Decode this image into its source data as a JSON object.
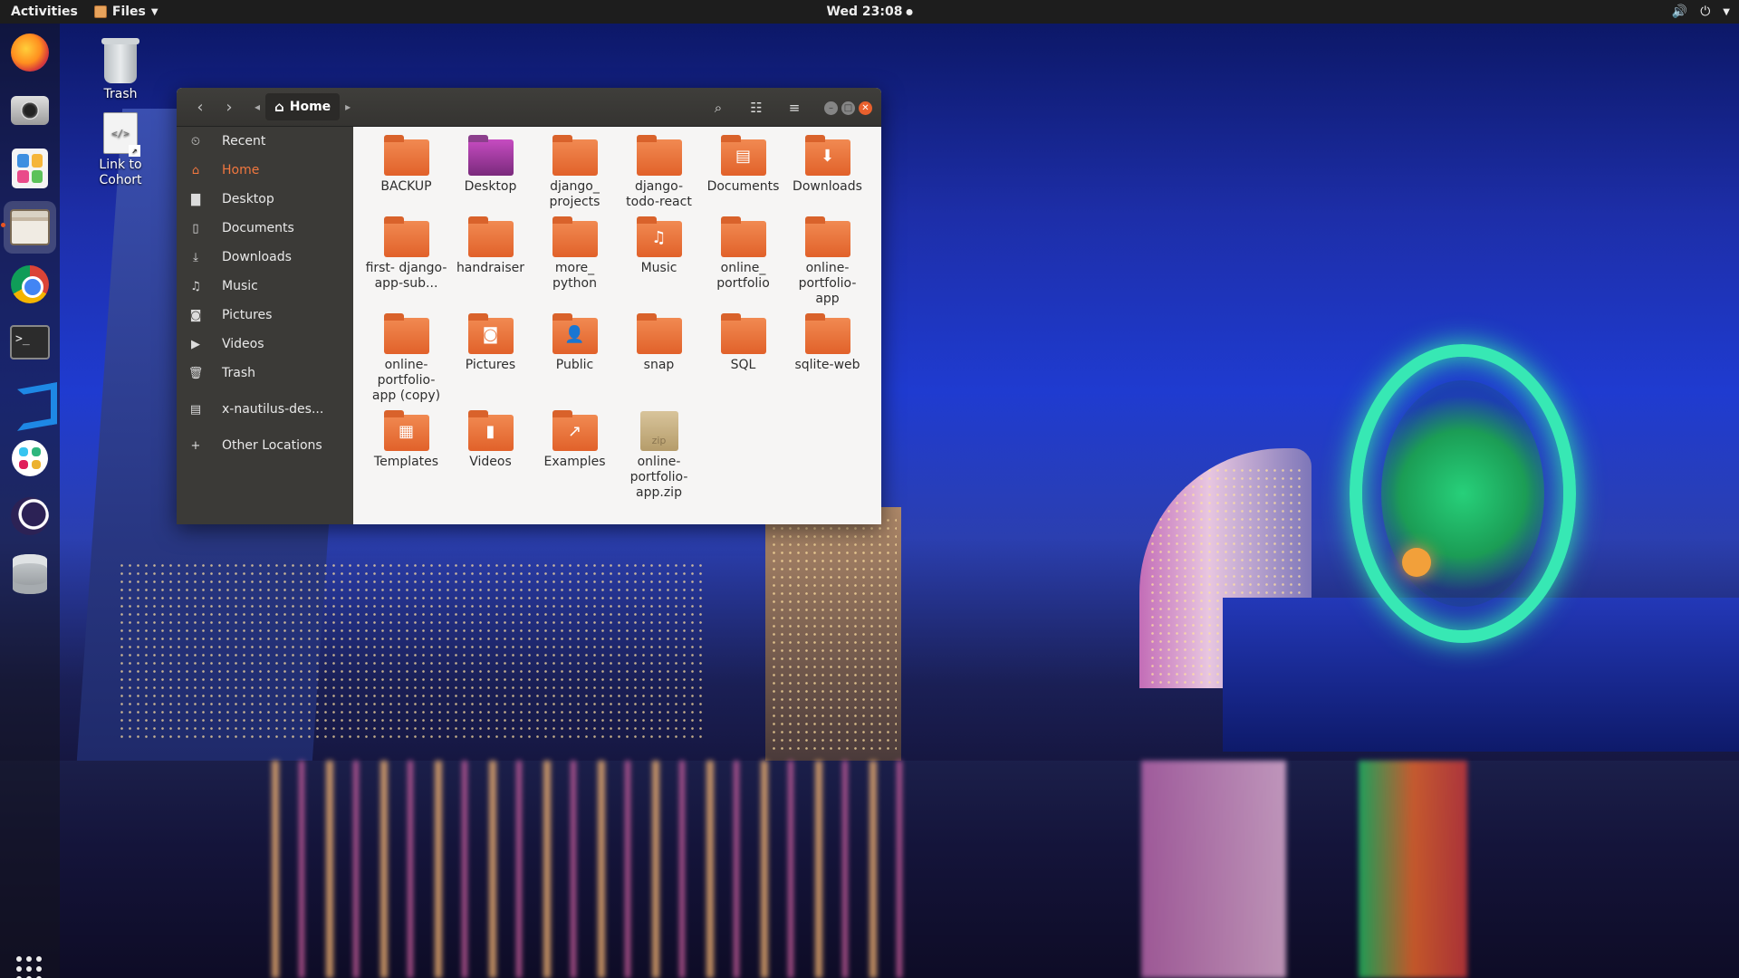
{
  "topbar": {
    "activities": "Activities",
    "app_name": "Files",
    "clock": "Wed 23:08"
  },
  "dock": {
    "apps": [
      "Firefox",
      "Camera",
      "Software",
      "Files",
      "Chrome",
      "Terminal",
      "VS Code",
      "Slack",
      "Eclipse",
      "Database"
    ],
    "active_app": "Files"
  },
  "desktop": {
    "icons": [
      {
        "label": "Trash",
        "icon": "trash-icon"
      },
      {
        "label": "Link to Cohort",
        "icon": "code-file-icon"
      }
    ]
  },
  "window": {
    "path_label": "Home",
    "sidebar": [
      {
        "label": "Recent",
        "icon": "recent-icon",
        "glyph": "⏲"
      },
      {
        "label": "Home",
        "icon": "home-icon",
        "glyph": "⌂",
        "active": true
      },
      {
        "label": "Desktop",
        "icon": "folder-icon",
        "glyph": "▇"
      },
      {
        "label": "Documents",
        "icon": "document-icon",
        "glyph": "▯"
      },
      {
        "label": "Downloads",
        "icon": "download-icon",
        "glyph": "⤓"
      },
      {
        "label": "Music",
        "icon": "music-icon",
        "glyph": "♫"
      },
      {
        "label": "Pictures",
        "icon": "camera-icon",
        "glyph": "◙"
      },
      {
        "label": "Videos",
        "icon": "video-icon",
        "glyph": "▶"
      },
      {
        "label": "Trash",
        "icon": "trash-icon",
        "glyph": "🗑"
      },
      {
        "label": "x-nautilus-des...",
        "icon": "drive-icon",
        "glyph": "▤"
      },
      {
        "label": "Other Locations",
        "icon": "plus-icon",
        "glyph": "+"
      }
    ],
    "items": [
      {
        "label": "BACKUP",
        "icon": "folder-icon",
        "emblem": ""
      },
      {
        "label": "Desktop",
        "icon": "desktop-folder-icon",
        "emblem": ""
      },
      {
        "label": "django_ projects",
        "icon": "folder-icon",
        "emblem": ""
      },
      {
        "label": "django- todo-react",
        "icon": "folder-icon",
        "emblem": ""
      },
      {
        "label": "Documents",
        "icon": "documents-folder-icon",
        "emblem": "▤"
      },
      {
        "label": "Downloads",
        "icon": "downloads-folder-icon",
        "emblem": "⬇"
      },
      {
        "label": "first- django- app-sub...",
        "icon": "folder-icon",
        "emblem": ""
      },
      {
        "label": "handraiser",
        "icon": "folder-icon",
        "emblem": ""
      },
      {
        "label": "more_ python",
        "icon": "folder-icon",
        "emblem": ""
      },
      {
        "label": "Music",
        "icon": "music-folder-icon",
        "emblem": "♫"
      },
      {
        "label": "online_ portfolio",
        "icon": "folder-icon",
        "emblem": ""
      },
      {
        "label": "online- portfolio- app",
        "icon": "folder-icon",
        "emblem": ""
      },
      {
        "label": "online- portfolio- app (copy)",
        "icon": "folder-icon",
        "emblem": ""
      },
      {
        "label": "Pictures",
        "icon": "pictures-folder-icon",
        "emblem": "◙"
      },
      {
        "label": "Public",
        "icon": "public-folder-icon",
        "emblem": "👤"
      },
      {
        "label": "snap",
        "icon": "folder-icon",
        "emblem": ""
      },
      {
        "label": "SQL",
        "icon": "folder-icon",
        "emblem": ""
      },
      {
        "label": "sqlite-web",
        "icon": "folder-icon",
        "emblem": ""
      },
      {
        "label": "Templates",
        "icon": "templates-folder-icon",
        "emblem": "▦"
      },
      {
        "label": "Videos",
        "icon": "videos-folder-icon",
        "emblem": "▮"
      },
      {
        "label": "Examples",
        "icon": "examples-link-icon",
        "emblem": "↗"
      },
      {
        "label": "online- portfolio- app.zip",
        "icon": "zip-archive-icon",
        "emblem": "zip"
      }
    ]
  }
}
